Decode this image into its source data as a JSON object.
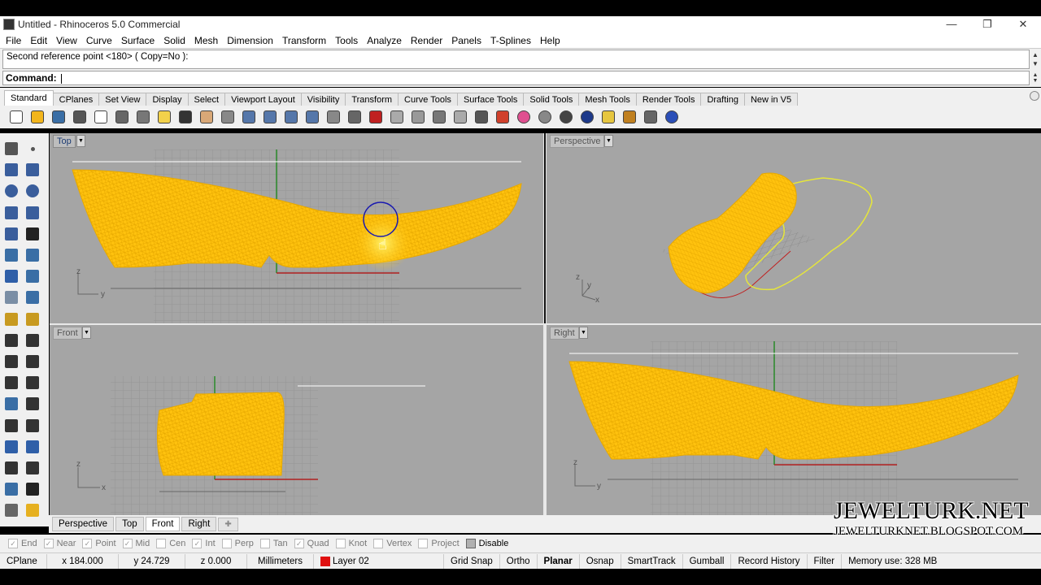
{
  "window": {
    "title": "Untitled - Rhinoceros 5.0 Commercial",
    "minimize": "—",
    "restore": "❐",
    "close": "✕"
  },
  "menu": [
    "File",
    "Edit",
    "View",
    "Curve",
    "Surface",
    "Solid",
    "Mesh",
    "Dimension",
    "Transform",
    "Tools",
    "Analyze",
    "Render",
    "Panels",
    "T-Splines",
    "Help"
  ],
  "command": {
    "history": "Second reference point <180> ( Copy=No ):",
    "label": "Command:",
    "value": ""
  },
  "toolbar_tabs": [
    "Standard",
    "CPlanes",
    "Set View",
    "Display",
    "Select",
    "Viewport Layout",
    "Visibility",
    "Transform",
    "Curve Tools",
    "Surface Tools",
    "Solid Tools",
    "Mesh Tools",
    "Render Tools",
    "Drafting",
    "New in V5"
  ],
  "toolbar_icons": [
    "new-icon",
    "open-icon",
    "save-icon",
    "print-icon",
    "import-icon",
    "cut-icon",
    "copy-icon",
    "paste-icon",
    "undo-icon",
    "pan-icon",
    "rotate-icon",
    "zoom-icon",
    "zoom-window-icon",
    "zoom-extents-icon",
    "zoom-selected-icon",
    "rotate-view-icon",
    "grid-icon",
    "car-icon",
    "hide-icon",
    "isolate-icon",
    "lock-icon",
    "bulb-icon",
    "lock2-icon",
    "layer-icon",
    "color-wheel-icon",
    "shade-icon",
    "render-icon",
    "sphere-icon",
    "flag-icon",
    "options-icon",
    "osnap-icon",
    "help-icon"
  ],
  "colors": {
    "accent_object": "#ffc20e",
    "viewport_bg": "#a5a5a5",
    "grid": "#959595",
    "selection_circle": "#1a1ab0",
    "x_axis": "#b02020",
    "y_axis": "#2a8a2a",
    "layer_swatch": "#e01010"
  },
  "viewports": {
    "top": "Top",
    "perspective": "Perspective",
    "front": "Front",
    "right": "Right",
    "axes": {
      "z": "z",
      "y": "y",
      "x": "x"
    }
  },
  "viewport_tabs": [
    "Perspective",
    "Top",
    "Front",
    "Right"
  ],
  "viewport_tab_add": "✚",
  "osnaps": [
    {
      "label": "End",
      "checked": true
    },
    {
      "label": "Near",
      "checked": true
    },
    {
      "label": "Point",
      "checked": true
    },
    {
      "label": "Mid",
      "checked": true
    },
    {
      "label": "Cen",
      "checked": false
    },
    {
      "label": "Int",
      "checked": true
    },
    {
      "label": "Perp",
      "checked": false
    },
    {
      "label": "Tan",
      "checked": false
    },
    {
      "label": "Quad",
      "checked": true
    },
    {
      "label": "Knot",
      "checked": false
    },
    {
      "label": "Vertex",
      "checked": false
    },
    {
      "label": "Project",
      "checked": false
    }
  ],
  "osnap_disable": "Disable",
  "status": {
    "cplane": "CPlane",
    "x": "x 184.000",
    "y": "y 24.729",
    "z": "z 0.000",
    "units": "Millimeters",
    "layer": "Layer 02",
    "grid_snap": "Grid Snap",
    "ortho": "Ortho",
    "planar": "Planar",
    "osnap": "Osnap",
    "smarttrack": "SmartTrack",
    "gumball": "Gumball",
    "record_history": "Record History",
    "filter": "Filter",
    "memory": "Memory use: 328 MB"
  },
  "watermark": {
    "title": "JEWELTURK.NET",
    "subtitle": "JEWELTURKNET.BLOGSPOT.COM"
  }
}
